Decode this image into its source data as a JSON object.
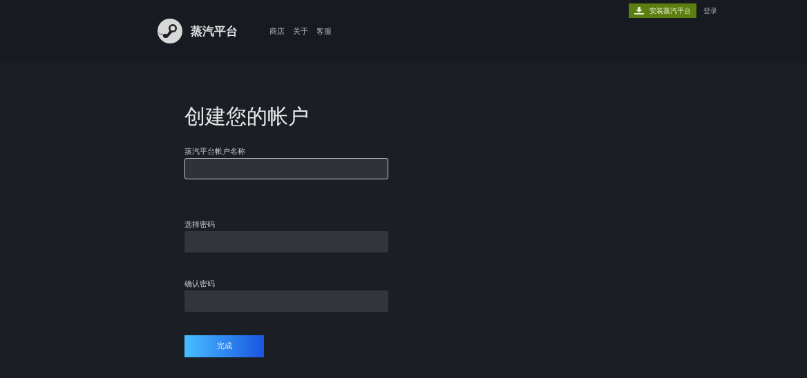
{
  "header": {
    "brand": "蒸汽平台",
    "nav": [
      "商店",
      "关于",
      "客服"
    ],
    "install_button": "安装蒸汽平台",
    "login_link": "登录"
  },
  "form": {
    "title": "创建您的帐户",
    "fields": [
      {
        "label": "蒸汽平台帐户名称",
        "focused": true
      },
      {
        "label": "选择密码",
        "focused": false
      },
      {
        "label": "确认密码",
        "focused": false
      }
    ],
    "submit_button": "完成"
  }
}
